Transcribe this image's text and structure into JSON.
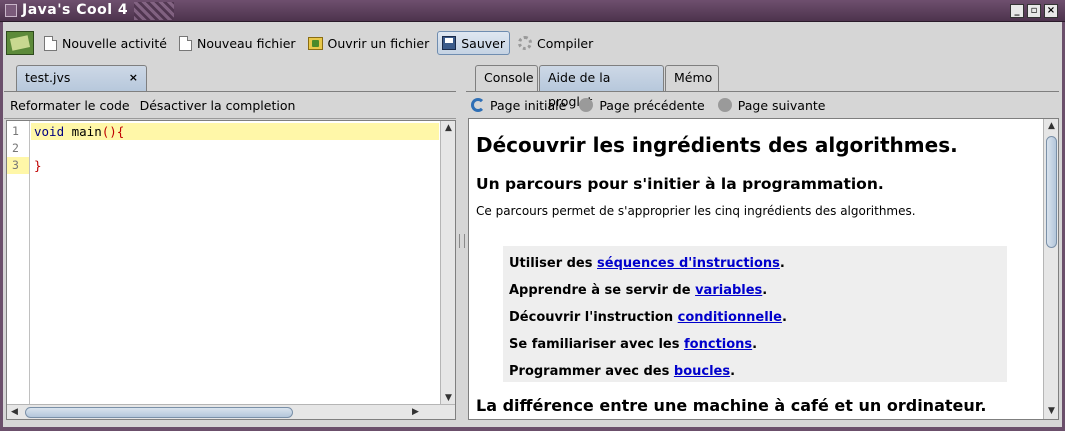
{
  "window": {
    "title": "Java's Cool 4"
  },
  "toolbar": {
    "new_activity": "Nouvelle activité",
    "new_file": "Nouveau fichier",
    "open_file": "Ouvrir un fichier",
    "save": "Sauver",
    "compile": "Compiler"
  },
  "editor": {
    "tab_label": "test.jvs",
    "tab_close": "×",
    "reformat": "Reformater le code",
    "disable_completion": "Désactiver la completion",
    "line_numbers": [
      "1",
      "2",
      "3"
    ],
    "code": {
      "line1_keyword": "void",
      "line1_rest": " main",
      "line1_brackets": "(){",
      "line3": "}"
    }
  },
  "right_tabs": {
    "console": "Console",
    "help": "Aide de la proglet",
    "memo": "Mémo"
  },
  "help_nav": {
    "home": "Page initiale",
    "previous": "Page précédente",
    "next": "Page suivante"
  },
  "help": {
    "title": "Découvrir les ingrédients des algorithmes.",
    "subtitle": "Un parcours pour s'initier à la programmation.",
    "intro": "Ce parcours permet de s'approprier les cinq ingrédients des algorithmes.",
    "items": [
      {
        "prefix": "Utiliser des ",
        "link": "séquences d'instructions",
        "suffix": "."
      },
      {
        "prefix": "Apprendre à se servir de ",
        "link": "variables",
        "suffix": "."
      },
      {
        "prefix": "Découvrir l'instruction ",
        "link": "conditionnelle",
        "suffix": "."
      },
      {
        "prefix": "Se familiariser avec les ",
        "link": "fonctions",
        "suffix": "."
      },
      {
        "prefix": "Programmer avec des ",
        "link": "boucles",
        "suffix": "."
      }
    ],
    "next_heading": "La différence entre une machine à café et un ordinateur."
  }
}
